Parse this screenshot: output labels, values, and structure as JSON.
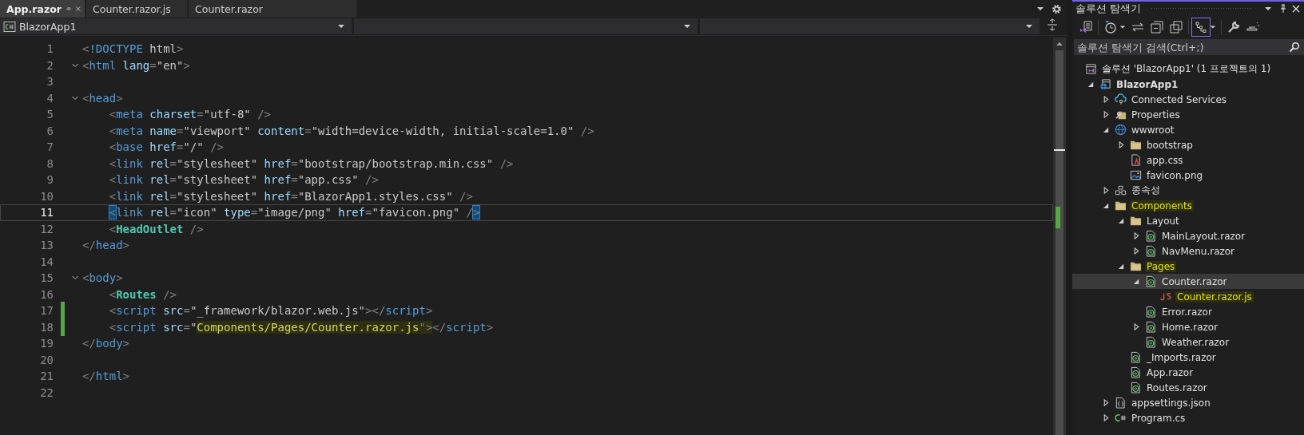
{
  "tabs": [
    {
      "label": "App.razor",
      "selected": true
    },
    {
      "label": "Counter.razor.js",
      "selected": false
    },
    {
      "label": "Counter.razor",
      "selected": false
    }
  ],
  "nav_bar": {
    "project": "BlazorApp1"
  },
  "editor": {
    "lines": [
      {
        "number": "1",
        "current": false,
        "changed": false,
        "foldable": false,
        "indented": false,
        "tokens": [
          {
            "kind": "punct",
            "text": "<"
          },
          {
            "kind": "tag",
            "text": "!DOCTYPE"
          },
          {
            "kind": "plain",
            "text": " html"
          },
          {
            "kind": "punct",
            "text": ">"
          }
        ]
      },
      {
        "number": "2",
        "current": false,
        "changed": false,
        "foldable": true,
        "indented": false,
        "tokens": [
          {
            "kind": "punct",
            "text": "<"
          },
          {
            "kind": "tag",
            "text": "html"
          },
          {
            "kind": "attr",
            "text": " lang"
          },
          {
            "kind": "punct",
            "text": "="
          },
          {
            "kind": "string",
            "text": "\"en\""
          },
          {
            "kind": "punct",
            "text": ">"
          }
        ]
      },
      {
        "number": "3",
        "current": false,
        "changed": false,
        "foldable": false
      },
      {
        "number": "4",
        "current": false,
        "changed": false,
        "foldable": true,
        "indented": false,
        "tokens": [
          {
            "kind": "punct",
            "text": "<"
          },
          {
            "kind": "tag",
            "text": "head"
          },
          {
            "kind": "punct",
            "text": ">"
          }
        ]
      },
      {
        "number": "5",
        "current": false,
        "changed": false,
        "foldable": false,
        "indented": true,
        "tokens": [
          {
            "kind": "punct",
            "text": "<"
          },
          {
            "kind": "tag",
            "text": "meta"
          },
          {
            "kind": "attr",
            "text": " charset"
          },
          {
            "kind": "punct",
            "text": "="
          },
          {
            "kind": "string",
            "text": "\"utf-8\""
          },
          {
            "kind": "punct",
            "text": " />"
          }
        ]
      },
      {
        "number": "6",
        "current": false,
        "changed": false,
        "foldable": false,
        "indented": true,
        "tokens": [
          {
            "kind": "punct",
            "text": "<"
          },
          {
            "kind": "tag",
            "text": "meta"
          },
          {
            "kind": "attr",
            "text": " name"
          },
          {
            "kind": "punct",
            "text": "="
          },
          {
            "kind": "string",
            "text": "\"viewport\""
          },
          {
            "kind": "attr",
            "text": " content"
          },
          {
            "kind": "punct",
            "text": "="
          },
          {
            "kind": "string",
            "text": "\"width=device-width, initial-scale=1.0\""
          },
          {
            "kind": "punct",
            "text": " />"
          }
        ]
      },
      {
        "number": "7",
        "current": false,
        "changed": false,
        "foldable": false,
        "indented": true,
        "tokens": [
          {
            "kind": "punct",
            "text": "<"
          },
          {
            "kind": "tag",
            "text": "base"
          },
          {
            "kind": "attr",
            "text": " href"
          },
          {
            "kind": "punct",
            "text": "="
          },
          {
            "kind": "string",
            "text": "\"/\""
          },
          {
            "kind": "punct",
            "text": " />"
          }
        ]
      },
      {
        "number": "8",
        "current": false,
        "changed": false,
        "foldable": false,
        "indented": true,
        "tokens": [
          {
            "kind": "punct",
            "text": "<"
          },
          {
            "kind": "tag",
            "text": "link"
          },
          {
            "kind": "attr",
            "text": " rel"
          },
          {
            "kind": "punct",
            "text": "="
          },
          {
            "kind": "string",
            "text": "\"stylesheet\""
          },
          {
            "kind": "attr",
            "text": " href"
          },
          {
            "kind": "punct",
            "text": "="
          },
          {
            "kind": "string",
            "text": "\"bootstrap/bootstrap.min.css\""
          },
          {
            "kind": "punct",
            "text": " />"
          }
        ]
      },
      {
        "number": "9",
        "current": false,
        "changed": false,
        "foldable": false,
        "indented": true,
        "tokens": [
          {
            "kind": "punct",
            "text": "<"
          },
          {
            "kind": "tag",
            "text": "link"
          },
          {
            "kind": "attr",
            "text": " rel"
          },
          {
            "kind": "punct",
            "text": "="
          },
          {
            "kind": "string",
            "text": "\"stylesheet\""
          },
          {
            "kind": "attr",
            "text": " href"
          },
          {
            "kind": "punct",
            "text": "="
          },
          {
            "kind": "string",
            "text": "\"app.css\""
          },
          {
            "kind": "punct",
            "text": " />"
          }
        ]
      },
      {
        "number": "10",
        "current": false,
        "changed": false,
        "foldable": false,
        "indented": true,
        "tokens": [
          {
            "kind": "punct",
            "text": "<"
          },
          {
            "kind": "tag",
            "text": "link"
          },
          {
            "kind": "attr",
            "text": " rel"
          },
          {
            "kind": "punct",
            "text": "="
          },
          {
            "kind": "string",
            "text": "\"stylesheet\""
          },
          {
            "kind": "attr",
            "text": " href"
          },
          {
            "kind": "punct",
            "text": "="
          },
          {
            "kind": "string",
            "text": "\"BlazorApp1.styles.css\""
          },
          {
            "kind": "punct",
            "text": " />"
          }
        ]
      },
      {
        "number": "11",
        "current": true,
        "changed": false,
        "foldable": false,
        "indented": true,
        "tokens": [
          {
            "kind": "bracket_match",
            "text": "<"
          },
          {
            "kind": "tag",
            "text": "link"
          },
          {
            "kind": "attr",
            "text": " rel"
          },
          {
            "kind": "punct",
            "text": "="
          },
          {
            "kind": "string",
            "text": "\"icon\""
          },
          {
            "kind": "attr",
            "text": " type"
          },
          {
            "kind": "punct",
            "text": "="
          },
          {
            "kind": "string",
            "text": "\"image/png\""
          },
          {
            "kind": "attr",
            "text": " href"
          },
          {
            "kind": "punct",
            "text": "="
          },
          {
            "kind": "string",
            "text": "\"favicon.png\""
          },
          {
            "kind": "punct",
            "text": " /"
          },
          {
            "kind": "bracket_match",
            "text": ">"
          }
        ]
      },
      {
        "number": "12",
        "current": false,
        "changed": false,
        "foldable": false,
        "indented": true,
        "tokens": [
          {
            "kind": "punct",
            "text": "<"
          },
          {
            "kind": "component",
            "text": "HeadOutlet"
          },
          {
            "kind": "punct",
            "text": " />"
          }
        ]
      },
      {
        "number": "13",
        "current": false,
        "changed": false,
        "foldable": false,
        "indented": false,
        "tokens": [
          {
            "kind": "punct",
            "text": "</"
          },
          {
            "kind": "tag",
            "text": "head"
          },
          {
            "kind": "punct",
            "text": ">"
          }
        ]
      },
      {
        "number": "14",
        "current": false,
        "changed": false,
        "foldable": false
      },
      {
        "number": "15",
        "current": false,
        "changed": false,
        "foldable": true,
        "indented": false,
        "tokens": [
          {
            "kind": "punct",
            "text": "<"
          },
          {
            "kind": "tag",
            "text": "body"
          },
          {
            "kind": "punct",
            "text": ">"
          }
        ]
      },
      {
        "number": "16",
        "current": false,
        "changed": false,
        "foldable": false,
        "indented": true,
        "tokens": [
          {
            "kind": "punct",
            "text": "<"
          },
          {
            "kind": "component",
            "text": "Routes"
          },
          {
            "kind": "punct",
            "text": " />"
          }
        ]
      },
      {
        "number": "17",
        "current": false,
        "changed": true,
        "foldable": false,
        "indented": true,
        "tokens": [
          {
            "kind": "punct",
            "text": "<"
          },
          {
            "kind": "tag",
            "text": "script"
          },
          {
            "kind": "attr",
            "text": " src"
          },
          {
            "kind": "punct",
            "text": "="
          },
          {
            "kind": "string",
            "text": "\"_framework/blazor.web.js\""
          },
          {
            "kind": "punct",
            "text": "></"
          },
          {
            "kind": "tag",
            "text": "script"
          },
          {
            "kind": "punct",
            "text": ">"
          }
        ]
      },
      {
        "number": "18",
        "current": false,
        "changed": true,
        "foldable": false,
        "indented": true,
        "tokens": [
          {
            "kind": "punct",
            "text": "<"
          },
          {
            "kind": "tag",
            "text": "script"
          },
          {
            "kind": "attr",
            "text": " src"
          },
          {
            "kind": "punct",
            "text": "="
          },
          {
            "kind": "string",
            "text": "\""
          },
          {
            "kind": "highlight",
            "text": "Components/Pages/Counter.razor.js"
          },
          {
            "kind": "highlight_punct",
            "text": "\">"
          },
          {
            "kind": "punct",
            "text": "</"
          },
          {
            "kind": "tag",
            "text": "script"
          },
          {
            "kind": "punct",
            "text": ">"
          }
        ]
      },
      {
        "number": "19",
        "current": false,
        "changed": false,
        "foldable": false,
        "indented": false,
        "tokens": [
          {
            "kind": "punct",
            "text": "</"
          },
          {
            "kind": "tag",
            "text": "body"
          },
          {
            "kind": "punct",
            "text": ">"
          }
        ]
      },
      {
        "number": "20",
        "current": false,
        "changed": false,
        "foldable": false
      },
      {
        "number": "21",
        "current": false,
        "changed": false,
        "foldable": false,
        "indented": false,
        "tokens": [
          {
            "kind": "punct",
            "text": "</"
          },
          {
            "kind": "tag",
            "text": "html"
          },
          {
            "kind": "punct",
            "text": ">"
          }
        ]
      },
      {
        "number": "22",
        "current": false,
        "changed": false,
        "foldable": false
      }
    ]
  },
  "solution_explorer": {
    "title": "솔루션 탐색기",
    "search": {
      "placeholder": "솔루션 탐색기 검색(Ctrl+;)"
    },
    "tree": [
      {
        "label": "솔루션 'BlazorApp1' (1 프로젝트의 1)",
        "kind": "solution",
        "expandable": false,
        "selected": false,
        "highlighted": false,
        "children": [
          {
            "label": "BlazorApp1",
            "kind": "project",
            "expandable": true,
            "expanded": true,
            "selected": false,
            "highlighted": false,
            "children": [
              {
                "label": "Connected Services",
                "kind": "connected",
                "expandable": true,
                "expanded": false,
                "selected": false,
                "highlighted": false
              },
              {
                "label": "Properties",
                "kind": "properties",
                "expandable": true,
                "expanded": false,
                "selected": false,
                "highlighted": false
              },
              {
                "label": "wwwroot",
                "kind": "globe",
                "expandable": true,
                "expanded": true,
                "selected": false,
                "highlighted": false,
                "children": [
                  {
                    "label": "bootstrap",
                    "kind": "folder",
                    "expandable": true,
                    "expanded": false,
                    "selected": false,
                    "highlighted": false
                  },
                  {
                    "label": "app.css",
                    "kind": "css",
                    "expandable": false,
                    "selected": false,
                    "highlighted": false
                  },
                  {
                    "label": "favicon.png",
                    "kind": "image",
                    "expandable": false,
                    "selected": false,
                    "highlighted": false
                  }
                ]
              },
              {
                "label": "종속성",
                "kind": "deps",
                "expandable": true,
                "expanded": false,
                "selected": false,
                "highlighted": false
              },
              {
                "label": "Components",
                "kind": "folder",
                "expandable": true,
                "expanded": true,
                "selected": false,
                "highlighted": true,
                "children": [
                  {
                    "label": "Layout",
                    "kind": "folder",
                    "expandable": true,
                    "expanded": true,
                    "selected": false,
                    "highlighted": false,
                    "children": [
                      {
                        "label": "MainLayout.razor",
                        "kind": "razor",
                        "expandable": true,
                        "expanded": false,
                        "selected": false,
                        "highlighted": false
                      },
                      {
                        "label": "NavMenu.razor",
                        "kind": "razor",
                        "expandable": true,
                        "expanded": false,
                        "selected": false,
                        "highlighted": false
                      }
                    ]
                  },
                  {
                    "label": "Pages",
                    "kind": "folder",
                    "expandable": true,
                    "expanded": true,
                    "selected": false,
                    "highlighted": true,
                    "children": [
                      {
                        "label": "Counter.razor",
                        "kind": "razor",
                        "expandable": true,
                        "expanded": true,
                        "selected": true,
                        "highlighted": false,
                        "children": [
                          {
                            "label": "Counter.razor.js",
                            "kind": "js",
                            "expandable": false,
                            "selected": false,
                            "highlighted": true
                          }
                        ]
                      },
                      {
                        "label": "Error.razor",
                        "kind": "razor",
                        "expandable": false,
                        "selected": false,
                        "highlighted": false
                      },
                      {
                        "label": "Home.razor",
                        "kind": "razor",
                        "expandable": true,
                        "expanded": false,
                        "selected": false,
                        "highlighted": false
                      },
                      {
                        "label": "Weather.razor",
                        "kind": "razor",
                        "expandable": false,
                        "selected": false,
                        "highlighted": false
                      }
                    ]
                  },
                  {
                    "label": "_Imports.razor",
                    "kind": "razor",
                    "expandable": false,
                    "selected": false,
                    "highlighted": false
                  },
                  {
                    "label": "App.razor",
                    "kind": "razor",
                    "expandable": false,
                    "selected": false,
                    "highlighted": false
                  },
                  {
                    "label": "Routes.razor",
                    "kind": "razor",
                    "expandable": false,
                    "selected": false,
                    "highlighted": false
                  }
                ]
              },
              {
                "label": "appsettings.json",
                "kind": "json",
                "expandable": true,
                "expanded": false,
                "selected": false,
                "highlighted": false
              },
              {
                "label": "Program.cs",
                "kind": "csharp",
                "expandable": true,
                "expanded": false,
                "selected": false,
                "highlighted": false
              }
            ]
          }
        ]
      }
    ]
  }
}
